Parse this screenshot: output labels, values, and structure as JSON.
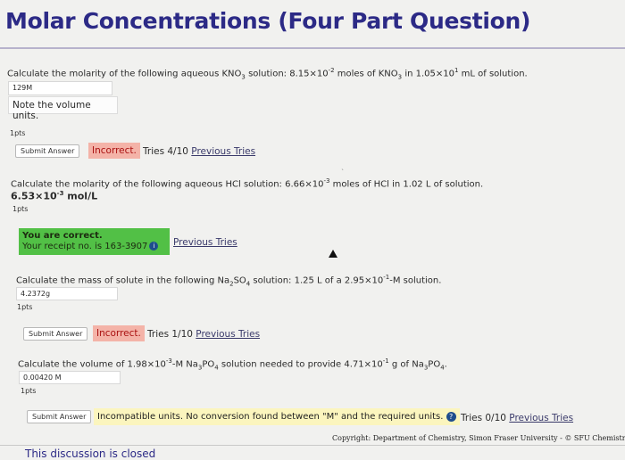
{
  "page": {
    "title": "Molar Concentrations (Four Part Question)"
  },
  "parts": [
    {
      "question_prefix": "Calculate the molarity of the following aqueous KNO",
      "question_mid1": " solution: 8.15×10",
      "exp1": "-2",
      "question_mid2": " moles of KNO",
      "question_mid3": " in 1.05×10",
      "exp2": "1",
      "question_suffix": " mL of solution.",
      "sub": "3",
      "answer_value": "129M",
      "tip": "Note the volume units.",
      "points": "1pts",
      "submit_label": "Submit Answer",
      "status": "Incorrect.",
      "tries": "Tries 4/10",
      "previous_tries": "Previous Tries"
    },
    {
      "question_prefix": "Calculate the molarity of the following aqueous HCl solution: 6.66×10",
      "exp1": "-3",
      "question_suffix": " moles of HCl in 1.02 L of solution.",
      "answer_main": "6.53×10",
      "answer_exp": "-3",
      "answer_unit": " mol/L",
      "points": "1pts",
      "correct_header": "You are correct.",
      "receipt": "Your receipt no. is 163-3907",
      "previous_tries": "Previous Tries"
    },
    {
      "question_prefix": "Calculate the mass of solute in the following Na",
      "sub1": "2",
      "question_mid1": "SO",
      "sub2": "4",
      "question_mid2": " solution: 1.25 L of a 2.95×10",
      "exp1": "-1",
      "question_suffix": "-M solution.",
      "answer_value": "4.2372g",
      "points": "1pts",
      "submit_label": "Submit Answer",
      "status": "Incorrect.",
      "tries": "Tries 1/10",
      "previous_tries": "Previous Tries"
    },
    {
      "question_prefix": "Calculate the volume of 1.98×10",
      "exp1": "-3",
      "question_mid1": "-M Na",
      "sub1": "3",
      "question_mid2": "PO",
      "sub2": "4",
      "question_mid3": " solution needed to provide 4.71×10",
      "exp2": "-1",
      "question_mid4": " g of Na",
      "sub3": "3",
      "question_mid5": "PO",
      "sub4": "4",
      "question_suffix": ".",
      "answer_value": "0.00420 M",
      "points": "1pts",
      "submit_label": "Submit Answer",
      "message": "Incompatible units. No conversion found between \"M\" and the required units.",
      "tries": "Tries 0/10",
      "previous_tries": "Previous Tries"
    }
  ],
  "footer": {
    "copyright": "Copyright: Department of Chemistry, Simon Fraser University - © SFU Chemistry",
    "discussion": "This discussion is closed"
  },
  "colors": {
    "title": "#2c2a86",
    "incorrect_bg": "#f4b3a8",
    "correct_bg": "#52c046",
    "message_bg": "#fbf5be"
  },
  "icons": [
    "info-icon",
    "help-icon",
    "mouse-cursor-icon"
  ]
}
